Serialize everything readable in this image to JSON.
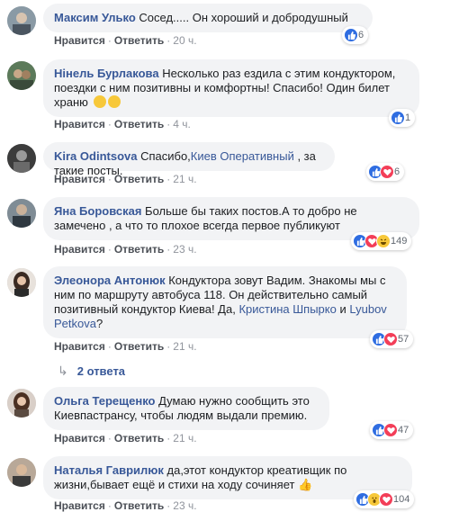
{
  "comments": [
    {
      "author": "Максим Улько",
      "text": " Сосед..... Он хороший и добродушный",
      "like_label": "Нравится",
      "reply_label": "Ответить",
      "time": "20 ч.",
      "reaction_count": "6"
    },
    {
      "author": "Нінель Бурлакова",
      "text": " Несколько раз ездила с этим кондуктором, поездки с ним позитивны и комфортны! Спасибо! Один билет храню",
      "like_label": "Нравится",
      "reply_label": "Ответить",
      "time": "4 ч.",
      "reaction_count": "1"
    },
    {
      "author": "Kira Odintsova",
      "text_before": " Спасибо,",
      "mention": "Киев Оперативный",
      "text_after": " , за такие посты.",
      "like_label": "Нравится",
      "reply_label": "Ответить",
      "time": "21 ч.",
      "reaction_count": "6"
    },
    {
      "author": "Яна Боровская",
      "text": " Больше бы таких постов.А то добро не замечено , а что то плохое всегда первое публикуют",
      "like_label": "Нравится",
      "reply_label": "Ответить",
      "time": "23 ч.",
      "reaction_count": "149"
    },
    {
      "author": "Элеонора Антонюк",
      "text": " Кондуктора зовут Вадим. Знакомы мы с ним по маршруту автобуса 118. Он действительно самый позитивный кондуктор Киева! Да, ",
      "mention1": "Кристина Шпырко",
      "and": " и ",
      "mention2": "Lyubov Petkova",
      "end": "?",
      "like_label": "Нравится",
      "reply_label": "Ответить",
      "time": "21 ч.",
      "reaction_count": "57",
      "replies": "2 ответа"
    },
    {
      "author": "Ольга Терещенко",
      "text": " Думаю нужно сообщить это Киевпастрансу, чтобы людям выдали премию.",
      "like_label": "Нравится",
      "reply_label": "Ответить",
      "time": "21 ч.",
      "reaction_count": "47"
    },
    {
      "author": "Наталья Гаврилюк",
      "text": " да,этот кондуктор креативщик по жизни,бывает ещё и стихи на ходу сочиняет",
      "like_label": "Нравится",
      "reply_label": "Ответить",
      "time": "23 ч.",
      "reaction_count": "104"
    }
  ],
  "separator": "·",
  "colors": {
    "link": "#385898",
    "bubble": "#f2f3f5",
    "meta": "#90949c"
  }
}
